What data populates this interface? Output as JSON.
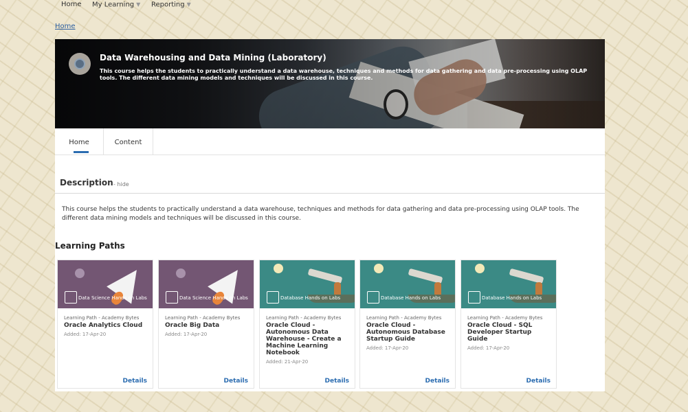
{
  "topnav": {
    "home": "Home",
    "my_learning": "My Learning",
    "reporting": "Reporting"
  },
  "breadcrumb": "Home",
  "course": {
    "title": "Data Warehousing and Data Mining (Laboratory)",
    "banner_desc": "This course helps the students to practically understand a data warehouse, techniques and methods for data gathering and data pre-processing using OLAP tools. The different data mining models and techniques will be discussed in this course."
  },
  "tabs": [
    "Home",
    "Content"
  ],
  "description": {
    "heading": "Description",
    "hide": "- hide",
    "text": "This course helps the students to practically understand a data warehouse, techniques and methods for data gathering and data pre-processing using OLAP tools. The different data mining models and techniques will be discussed in this course."
  },
  "learning_paths": {
    "heading": "Learning Paths",
    "cards": [
      {
        "image_label": "Data Science Hands on Labs",
        "meta": "Learning Path - Academy Bytes",
        "title": "Oracle Analytics Cloud",
        "added": "Added: 17-Apr-20",
        "details": "Details"
      },
      {
        "image_label": "Data Science Hands on Labs",
        "meta": "Learning Path - Academy Bytes",
        "title": "Oracle Big Data",
        "added": "Added: 17-Apr-20",
        "details": "Details"
      },
      {
        "image_label": "Database Hands on Labs",
        "meta": "Learning Path - Academy Bytes",
        "title": "Oracle Cloud - Autonomous Data Warehouse - Create a Machine Learning Notebook",
        "added": "Added: 21-Apr-20",
        "details": "Details"
      },
      {
        "image_label": "Database Hands on Labs",
        "meta": "Learning Path - Academy Bytes",
        "title": "Oracle Cloud - Autonomous Database Startup Guide",
        "added": "Added: 17-Apr-20",
        "details": "Details"
      },
      {
        "image_label": "Database Hands on Labs",
        "meta": "Learning Path - Academy Bytes",
        "title": "Oracle Cloud - SQL Developer Startup Guide",
        "added": "Added: 17-Apr-20",
        "details": "Details"
      }
    ]
  }
}
